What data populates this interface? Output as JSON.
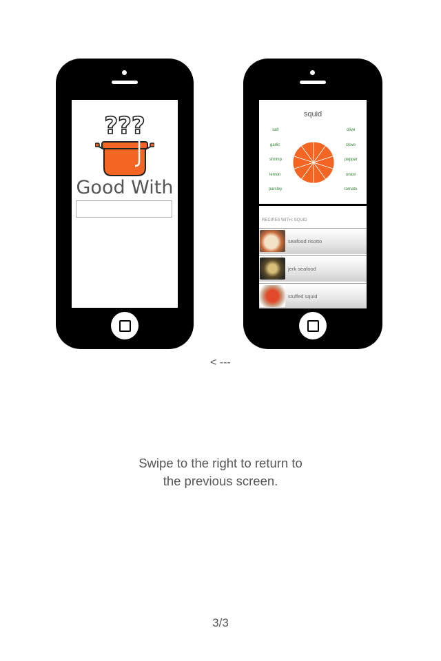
{
  "left_phone": {
    "question_marks": "???",
    "pot_icon": "pot-icon",
    "title": "Good With",
    "search_value": ""
  },
  "right_phone": {
    "ingredient_title": "squid",
    "left_ingredients": [
      "salt",
      "garlic",
      "shrimp",
      "lemon",
      "parsley"
    ],
    "right_ingredients": [
      "olive",
      "clove",
      "pepper",
      "onion",
      "tomato"
    ],
    "wheel_color": "#f26522",
    "recipes_header": "RECIPES WITH: SQUID",
    "recipes": [
      "seafood risotto",
      "jerk seafood",
      "stuffed squid"
    ]
  },
  "accent_color": "#f26522",
  "arrow_text": "< ---",
  "instruction_line1": "Swipe to the right to return to",
  "instruction_line2": "the previous screen.",
  "page_indicator": "3/3"
}
